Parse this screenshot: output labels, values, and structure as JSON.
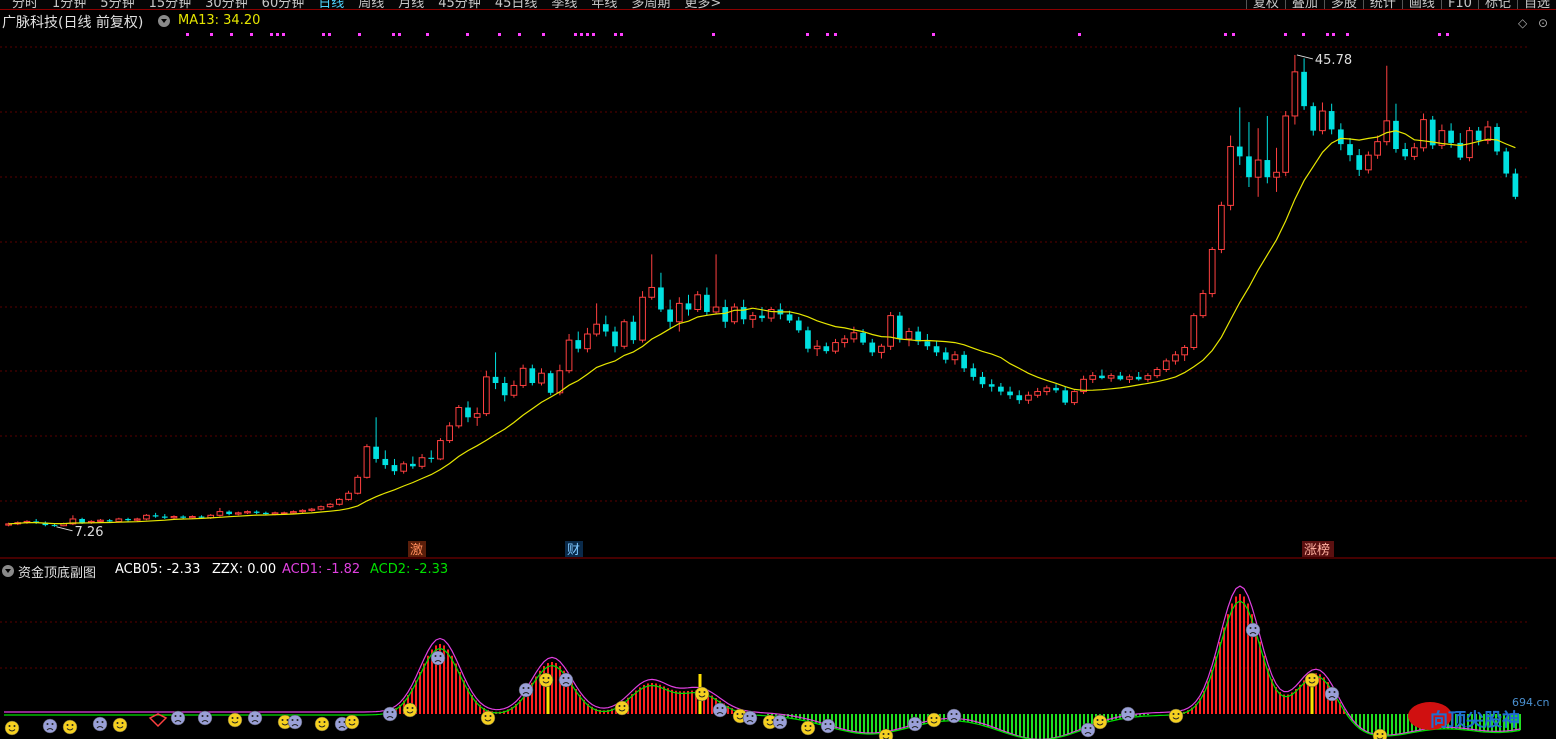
{
  "toolbar": {
    "periods": [
      "分时",
      "1分钟",
      "5分钟",
      "15分钟",
      "30分钟",
      "60分钟",
      "日线",
      "周线",
      "月线",
      "45分钟",
      "45日线",
      "季线",
      "年线",
      "多周期",
      "更多>"
    ],
    "active_period": "日线",
    "right_buttons": [
      "复权",
      "叠加",
      "多股",
      "统计",
      "画线",
      "F10",
      "标记",
      "自选"
    ]
  },
  "main_panel": {
    "stock_title": "广脉科技(日线 前复权)",
    "indicator_label": "MA13: 34.20",
    "indicator_color": "#e6e600",
    "high_label": "45.78",
    "low_label": "7.26",
    "markers": [
      {
        "text": "激",
        "color": "#ff8c5a",
        "bg": "#5a1e0a"
      },
      {
        "text": "财",
        "color": "#7fc8ff",
        "bg": "#0a2a4a"
      },
      {
        "text": "涨榜",
        "color": "#ffb0a0",
        "bg": "#5a1010"
      }
    ]
  },
  "sub_panel": {
    "title": "资金顶底副图",
    "acb05": "ACB05: -2.33",
    "zzx": "ZZX: 0.00",
    "acd1": "ACD1: -1.82",
    "acd2": "ACD2: -2.33",
    "colors": {
      "acb05": "#ffffff",
      "zzx": "#ffffff",
      "acd1": "#e040e0",
      "acd2": "#00e000"
    }
  },
  "watermark": {
    "text": "向顶尖股神",
    "domain": "694.cn"
  },
  "colors": {
    "up": "#ff4040",
    "down": "#00e0e0",
    "ma": "#e6e600",
    "grid": "#5a0000"
  },
  "chart_data": {
    "type": "candlestick",
    "series": [
      {
        "name": "MA13"
      }
    ],
    "candles": [
      [
        7.4,
        7.6,
        7.3,
        7.5
      ],
      [
        7.5,
        7.7,
        7.4,
        7.6
      ],
      [
        7.6,
        7.8,
        7.5,
        7.7
      ],
      [
        7.7,
        7.9,
        7.5,
        7.6
      ],
      [
        7.6,
        7.7,
        7.3,
        7.4
      ],
      [
        7.4,
        7.5,
        7.26,
        7.35
      ],
      [
        7.35,
        7.6,
        7.3,
        7.5
      ],
      [
        7.5,
        8.2,
        7.4,
        7.9
      ],
      [
        7.9,
        8.0,
        7.5,
        7.6
      ],
      [
        7.6,
        7.8,
        7.5,
        7.7
      ],
      [
        7.7,
        7.9,
        7.6,
        7.8
      ],
      [
        7.8,
        7.9,
        7.6,
        7.7
      ],
      [
        7.7,
        8.0,
        7.6,
        7.9
      ],
      [
        7.9,
        8.0,
        7.7,
        7.8
      ],
      [
        7.8,
        8.0,
        7.7,
        7.9
      ],
      [
        7.9,
        8.3,
        7.8,
        8.2
      ],
      [
        8.2,
        8.4,
        8.0,
        8.1
      ],
      [
        8.1,
        8.3,
        7.9,
        8.0
      ],
      [
        8.0,
        8.2,
        7.9,
        8.1
      ],
      [
        8.1,
        8.2,
        7.9,
        8.0
      ],
      [
        8.0,
        8.2,
        7.9,
        8.1
      ],
      [
        8.1,
        8.2,
        7.9,
        8.0
      ],
      [
        8.0,
        8.3,
        7.9,
        8.2
      ],
      [
        8.2,
        8.8,
        8.1,
        8.5
      ],
      [
        8.5,
        8.6,
        8.2,
        8.3
      ],
      [
        8.3,
        8.5,
        8.2,
        8.4
      ],
      [
        8.4,
        8.6,
        8.3,
        8.5
      ],
      [
        8.5,
        8.6,
        8.3,
        8.4
      ],
      [
        8.4,
        8.5,
        8.2,
        8.3
      ],
      [
        8.3,
        8.5,
        8.2,
        8.4
      ],
      [
        8.4,
        8.5,
        8.3,
        8.4
      ],
      [
        8.4,
        8.6,
        8.3,
        8.5
      ],
      [
        8.5,
        8.7,
        8.4,
        8.6
      ],
      [
        8.6,
        8.8,
        8.5,
        8.7
      ],
      [
        8.7,
        9.0,
        8.6,
        8.9
      ],
      [
        8.9,
        9.2,
        8.8,
        9.1
      ],
      [
        9.1,
        9.6,
        9.0,
        9.5
      ],
      [
        9.5,
        10.2,
        9.4,
        10.0
      ],
      [
        10.0,
        11.5,
        9.9,
        11.3
      ],
      [
        11.3,
        14.0,
        11.2,
        13.8
      ],
      [
        13.8,
        16.2,
        12.5,
        12.8
      ],
      [
        12.8,
        13.5,
        12.0,
        12.3
      ],
      [
        12.3,
        12.8,
        11.5,
        11.8
      ],
      [
        11.8,
        12.6,
        11.6,
        12.4
      ],
      [
        12.4,
        13.0,
        12.0,
        12.2
      ],
      [
        12.2,
        13.2,
        12.0,
        12.9
      ],
      [
        12.9,
        13.5,
        12.5,
        12.8
      ],
      [
        12.8,
        14.5,
        12.7,
        14.3
      ],
      [
        14.3,
        15.8,
        14.1,
        15.5
      ],
      [
        15.5,
        17.2,
        15.3,
        17.0
      ],
      [
        17.0,
        17.5,
        15.8,
        16.2
      ],
      [
        16.2,
        17.0,
        15.5,
        16.5
      ],
      [
        16.5,
        20.0,
        16.3,
        19.5
      ],
      [
        19.5,
        21.5,
        18.5,
        19.0
      ],
      [
        19.0,
        19.5,
        17.5,
        18.0
      ],
      [
        18.0,
        19.2,
        17.8,
        18.8
      ],
      [
        18.8,
        20.5,
        18.6,
        20.2
      ],
      [
        20.2,
        20.5,
        18.8,
        19.0
      ],
      [
        19.0,
        20.2,
        18.8,
        19.8
      ],
      [
        19.8,
        20.0,
        18.0,
        18.2
      ],
      [
        18.2,
        20.5,
        18.0,
        20.0
      ],
      [
        20.0,
        23.0,
        19.8,
        22.5
      ],
      [
        22.5,
        23.2,
        21.5,
        21.8
      ],
      [
        21.8,
        23.5,
        21.5,
        23.0
      ],
      [
        23.0,
        25.5,
        22.8,
        23.8
      ],
      [
        23.8,
        24.5,
        22.8,
        23.2
      ],
      [
        23.2,
        23.6,
        21.5,
        22.0
      ],
      [
        22.0,
        24.2,
        21.8,
        24.0
      ],
      [
        24.0,
        24.5,
        22.2,
        22.5
      ],
      [
        22.5,
        26.5,
        22.3,
        26.0
      ],
      [
        26.0,
        29.5,
        25.8,
        26.8
      ],
      [
        26.8,
        28.0,
        24.8,
        25.0
      ],
      [
        25.0,
        25.8,
        23.5,
        24.0
      ],
      [
        24.0,
        26.0,
        23.2,
        25.5
      ],
      [
        25.5,
        26.2,
        24.5,
        25.0
      ],
      [
        25.0,
        26.5,
        24.8,
        26.2
      ],
      [
        26.2,
        26.8,
        24.5,
        24.8
      ],
      [
        24.8,
        29.5,
        24.6,
        25.2
      ],
      [
        25.2,
        25.8,
        23.5,
        24.0
      ],
      [
        24.0,
        25.5,
        23.8,
        25.2
      ],
      [
        25.2,
        25.8,
        23.8,
        24.2
      ],
      [
        24.2,
        24.8,
        23.5,
        24.5
      ],
      [
        24.5,
        25.2,
        24.0,
        24.3
      ],
      [
        24.3,
        25.2,
        24.0,
        25.0
      ],
      [
        25.0,
        25.5,
        24.2,
        24.6
      ],
      [
        24.6,
        24.9,
        23.9,
        24.1
      ],
      [
        24.1,
        24.4,
        23.1,
        23.3
      ],
      [
        23.3,
        23.6,
        21.5,
        21.8
      ],
      [
        21.8,
        22.5,
        21.2,
        22.0
      ],
      [
        22.0,
        22.3,
        21.4,
        21.6
      ],
      [
        21.6,
        22.6,
        21.4,
        22.3
      ],
      [
        22.3,
        22.9,
        21.9,
        22.6
      ],
      [
        22.6,
        23.6,
        22.3,
        23.1
      ],
      [
        23.1,
        23.4,
        22.1,
        22.3
      ],
      [
        22.3,
        22.6,
        21.2,
        21.5
      ],
      [
        21.5,
        22.2,
        21.0,
        22.0
      ],
      [
        22.0,
        24.8,
        21.7,
        24.5
      ],
      [
        24.5,
        24.8,
        22.3,
        22.6
      ],
      [
        22.6,
        23.5,
        22.0,
        23.2
      ],
      [
        23.2,
        23.6,
        22.1,
        22.4
      ],
      [
        22.4,
        23.0,
        21.7,
        22.0
      ],
      [
        22.0,
        22.4,
        21.2,
        21.5
      ],
      [
        21.5,
        21.9,
        20.6,
        20.9
      ],
      [
        20.9,
        21.6,
        20.5,
        21.3
      ],
      [
        21.3,
        21.6,
        19.9,
        20.2
      ],
      [
        20.2,
        20.6,
        19.2,
        19.5
      ],
      [
        19.5,
        19.9,
        18.6,
        18.9
      ],
      [
        18.9,
        19.3,
        18.3,
        18.7
      ],
      [
        18.7,
        19.0,
        18.0,
        18.3
      ],
      [
        18.3,
        18.7,
        17.7,
        18.0
      ],
      [
        18.0,
        18.4,
        17.3,
        17.6
      ],
      [
        17.6,
        18.3,
        17.3,
        18.0
      ],
      [
        18.0,
        18.6,
        17.8,
        18.3
      ],
      [
        18.3,
        18.8,
        18.0,
        18.6
      ],
      [
        18.6,
        18.9,
        18.2,
        18.4
      ],
      [
        18.4,
        18.7,
        17.2,
        17.4
      ],
      [
        17.4,
        18.4,
        17.2,
        18.3
      ],
      [
        18.3,
        19.6,
        18.1,
        19.3
      ],
      [
        19.3,
        19.9,
        19.0,
        19.6
      ],
      [
        19.6,
        20.1,
        19.3,
        19.4
      ],
      [
        19.4,
        19.8,
        19.1,
        19.6
      ],
      [
        19.6,
        19.9,
        19.2,
        19.3
      ],
      [
        19.3,
        19.7,
        19.0,
        19.5
      ],
      [
        19.5,
        19.9,
        19.2,
        19.3
      ],
      [
        19.3,
        19.8,
        19.1,
        19.6
      ],
      [
        19.6,
        20.3,
        19.4,
        20.1
      ],
      [
        20.1,
        21.0,
        19.9,
        20.8
      ],
      [
        20.8,
        21.6,
        20.5,
        21.3
      ],
      [
        21.3,
        22.1,
        20.8,
        21.9
      ],
      [
        21.9,
        24.7,
        21.7,
        24.5
      ],
      [
        24.5,
        26.6,
        24.3,
        26.3
      ],
      [
        26.3,
        30.1,
        26.0,
        29.9
      ],
      [
        29.9,
        33.8,
        29.6,
        33.5
      ],
      [
        33.5,
        39.2,
        33.1,
        38.3
      ],
      [
        38.3,
        41.5,
        36.8,
        37.5
      ],
      [
        37.5,
        40.3,
        35.0,
        35.8
      ],
      [
        35.8,
        39.8,
        34.2,
        37.2
      ],
      [
        37.2,
        40.8,
        35.3,
        35.8
      ],
      [
        35.8,
        38.2,
        34.6,
        36.2
      ],
      [
        36.2,
        41.2,
        35.9,
        40.8
      ],
      [
        40.8,
        45.78,
        40.1,
        44.4
      ],
      [
        44.4,
        45.5,
        41.3,
        41.6
      ],
      [
        41.6,
        41.9,
        39.2,
        39.6
      ],
      [
        39.6,
        41.9,
        39.3,
        41.2
      ],
      [
        41.2,
        41.8,
        39.3,
        39.7
      ],
      [
        39.7,
        40.2,
        38.0,
        38.5
      ],
      [
        38.5,
        39.0,
        37.1,
        37.6
      ],
      [
        37.6,
        38.1,
        35.9,
        36.4
      ],
      [
        36.4,
        37.9,
        36.1,
        37.6
      ],
      [
        37.6,
        39.2,
        37.3,
        38.7
      ],
      [
        38.7,
        44.9,
        38.4,
        40.4
      ],
      [
        40.4,
        41.8,
        37.8,
        38.1
      ],
      [
        38.1,
        38.6,
        37.2,
        37.5
      ],
      [
        37.5,
        38.6,
        37.2,
        38.2
      ],
      [
        38.2,
        41.0,
        37.9,
        40.5
      ],
      [
        40.5,
        40.8,
        38.1,
        38.4
      ],
      [
        38.4,
        40.1,
        38.1,
        39.6
      ],
      [
        39.6,
        40.2,
        38.2,
        38.6
      ],
      [
        38.6,
        39.4,
        37.2,
        37.4
      ],
      [
        37.4,
        39.9,
        37.1,
        39.6
      ],
      [
        39.6,
        39.9,
        38.4,
        38.8
      ],
      [
        38.8,
        40.4,
        38.5,
        39.9
      ],
      [
        39.9,
        40.2,
        37.6,
        37.9
      ],
      [
        37.9,
        38.2,
        35.8,
        36.1
      ],
      [
        36.1,
        36.5,
        34.0,
        34.2
      ]
    ],
    "y_range": [
      7.0,
      47.0
    ]
  }
}
